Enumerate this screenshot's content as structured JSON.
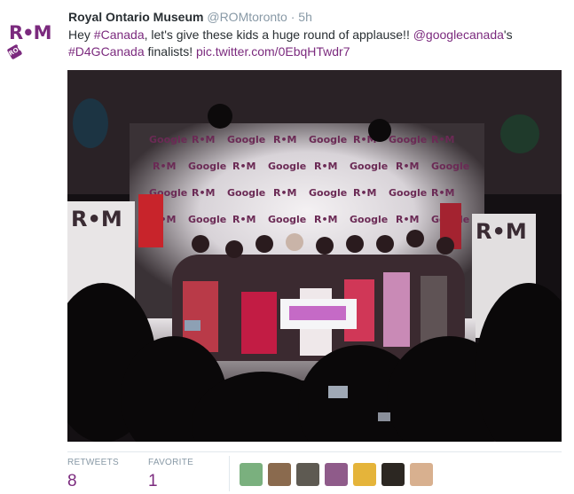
{
  "tweet": {
    "author_name": "Royal Ontario Museum",
    "author_handle": "@ROMtoronto",
    "separator": "·",
    "timestamp": "5h",
    "avatar_text": "R•M",
    "avatar_badge": "ROM",
    "text_parts": [
      {
        "text": "Hey ",
        "kind": "plain"
      },
      {
        "text": "#Canada",
        "kind": "link"
      },
      {
        "text": ", let's give these kids a huge round of applause!! ",
        "kind": "plain"
      },
      {
        "text": "@googlecanada",
        "kind": "link"
      },
      {
        "text": "'s ",
        "kind": "plain"
      },
      {
        "text": "#D4GCanada",
        "kind": "link"
      },
      {
        "text": " finalists! ",
        "kind": "plain"
      },
      {
        "text": "pic.twitter.com/0EbqHTwdr7",
        "kind": "link"
      }
    ]
  },
  "photo": {
    "backdrop_words": [
      "Google",
      "R•M"
    ],
    "banner_text": "R•M"
  },
  "stats": {
    "retweets_label": "RETWEETS",
    "retweets_count": "8",
    "favorites_label": "FAVORITE",
    "favorites_count": "1"
  },
  "favoriters": [
    {
      "name": "favoriter-avatar-1",
      "color": "#7ab07e"
    },
    {
      "name": "favoriter-avatar-2",
      "color": "#8a6a4e"
    },
    {
      "name": "favoriter-avatar-3",
      "color": "#5e5a52"
    },
    {
      "name": "favoriter-avatar-4",
      "color": "#8f5b8a"
    },
    {
      "name": "favoriter-avatar-5",
      "color": "#e5b43a"
    },
    {
      "name": "favoriter-avatar-6",
      "color": "#2c2722"
    },
    {
      "name": "favoriter-avatar-7",
      "color": "#d8b08f"
    }
  ],
  "colors": {
    "accent": "#7b2a7e",
    "muted": "#8899a6",
    "text": "#292f33"
  }
}
